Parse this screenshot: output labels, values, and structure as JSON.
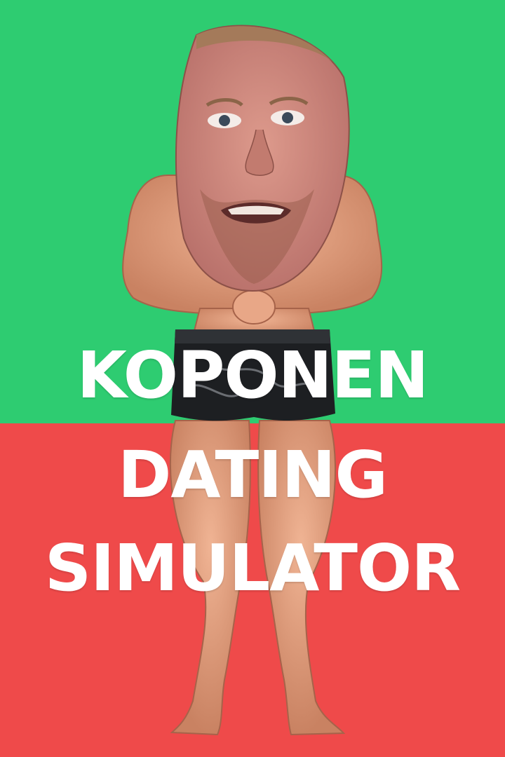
{
  "title": {
    "line1": "KOPONEN",
    "line2": "DATING",
    "line3": "SIMULATOR"
  },
  "colors": {
    "top_background": "#2ECC71",
    "bottom_background": "#EF4A4A",
    "title_text": "#FFFFFF"
  },
  "character": {
    "icon": "bodybuilder-character"
  }
}
